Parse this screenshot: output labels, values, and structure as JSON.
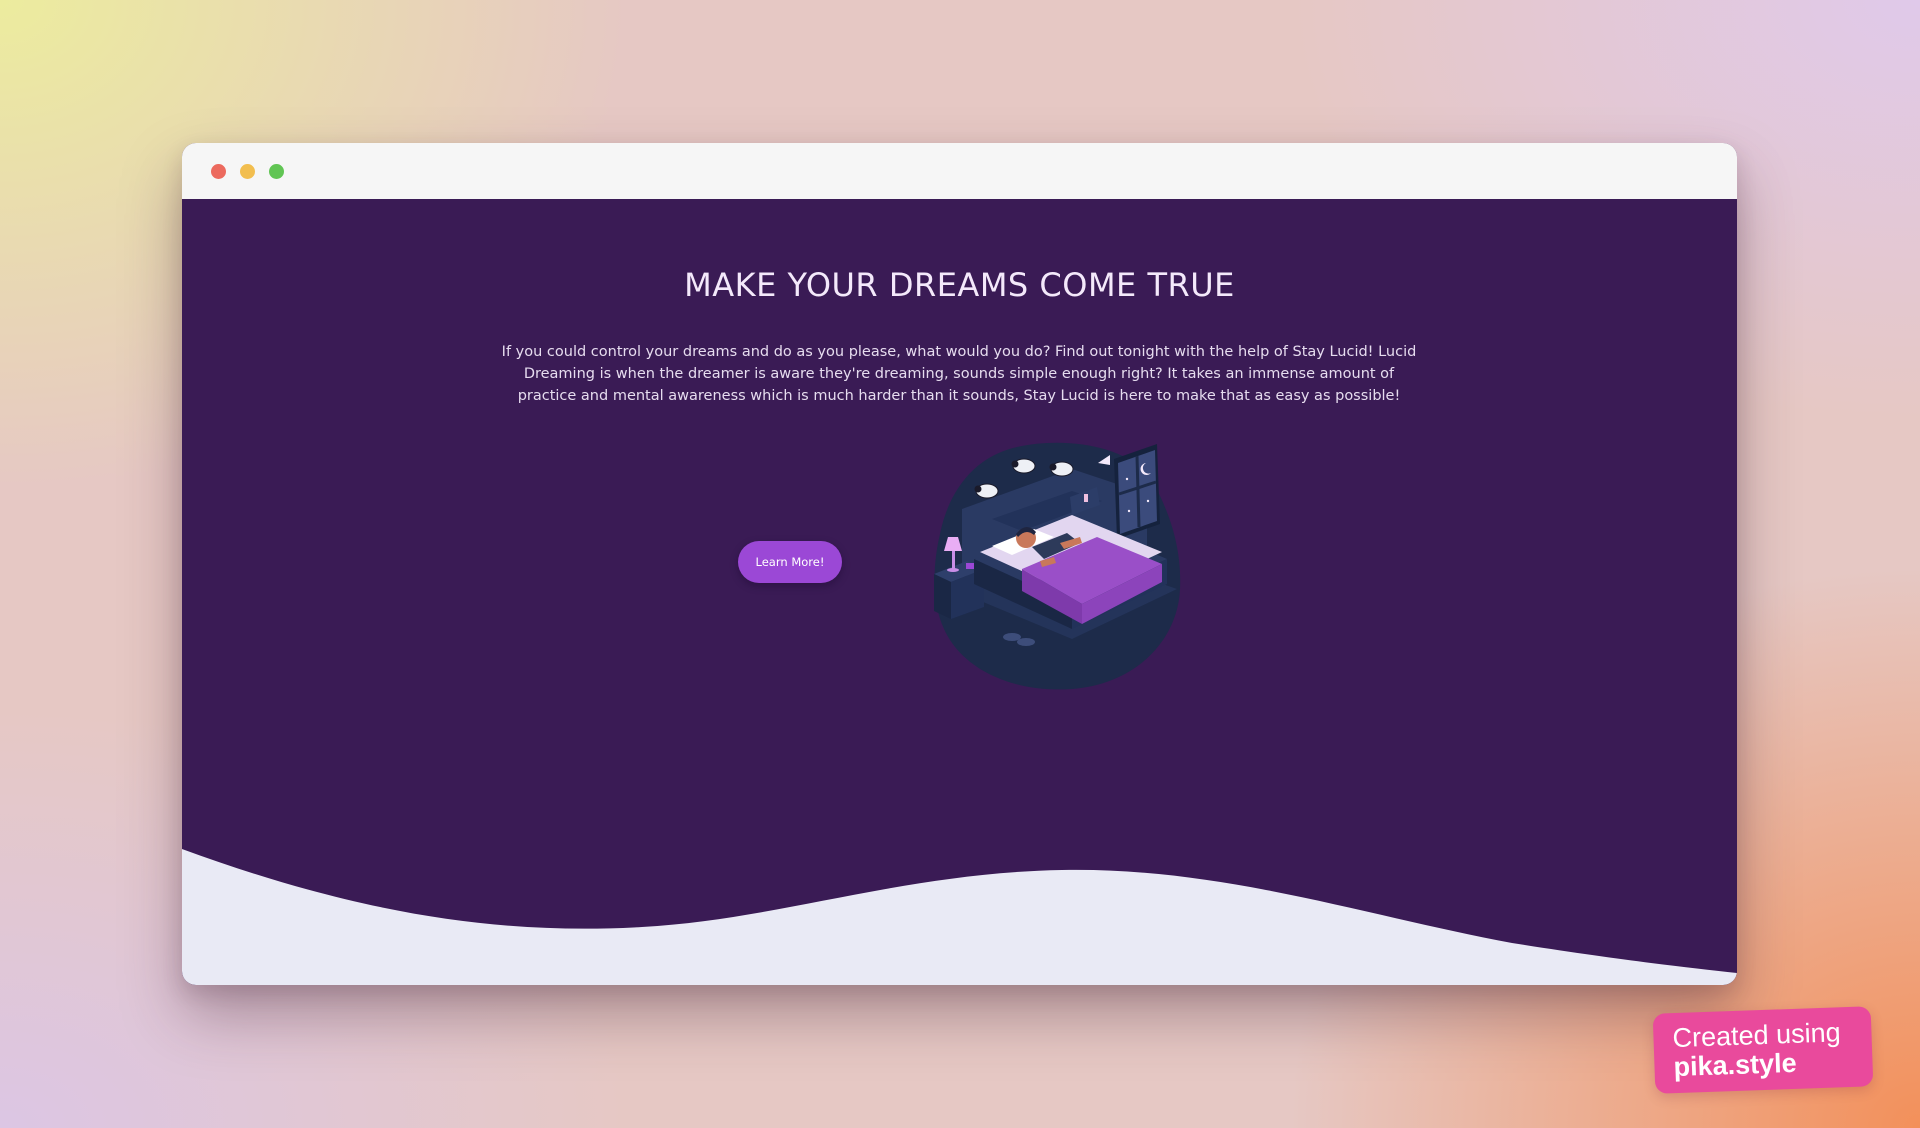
{
  "browser": {
    "controls": [
      "close",
      "minimize",
      "maximize"
    ]
  },
  "hero": {
    "title": "MAKE YOUR DREAMS COME TRUE",
    "description": "If you could control your dreams and do as you please, what would you do? Find out tonight with the help of Stay Lucid! Lucid Dreaming is when the dreamer is aware they're dreaming, sounds simple enough right? It takes an immense amount of practice and mental awareness which is much harder than it sounds, Stay Lucid is here to make that as easy as possible!",
    "cta_label": "Learn More!",
    "illustration": "sleeping-person-bedroom-illustration"
  },
  "watermark": {
    "line1": "Created using",
    "line2": "pika.style"
  },
  "colors": {
    "page_bg": "#3a1b55",
    "accent": "#9b48d6",
    "wave": "#e9eaf5",
    "titlebar": "#f6f6f6",
    "badge": "#e94a9c"
  }
}
